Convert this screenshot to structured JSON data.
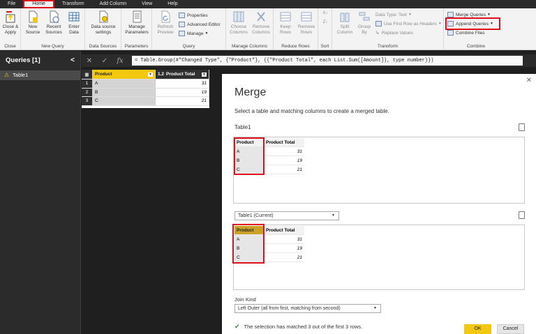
{
  "menu": [
    "File",
    "Home",
    "Transform",
    "Add Column",
    "View",
    "Help"
  ],
  "ribbon": {
    "close_group": {
      "label": "Close",
      "button": "Close &\nApply"
    },
    "new_query_group": {
      "label": "New Query",
      "new_source": "New\nSource",
      "recent_sources": "Recent\nSources",
      "enter_data": "Enter\nData"
    },
    "data_sources_group": {
      "label": "Data Sources",
      "button": "Data source\nsettings"
    },
    "parameters_group": {
      "label": "Parameters",
      "button": "Manage\nParameters"
    },
    "query_group": {
      "label": "Query",
      "refresh": "Refresh\nPreview",
      "properties": "Properties",
      "advanced_editor": "Advanced Editor",
      "manage": "Manage"
    },
    "manage_columns_group": {
      "label": "Manage Columns",
      "choose": "Choose\nColumns",
      "remove": "Remove\nColumns"
    },
    "reduce_rows_group": {
      "label": "Reduce Rows",
      "keep": "Keep\nRows",
      "remove": "Remove\nRows"
    },
    "sort_group": {
      "label": "Sort"
    },
    "transform_group": {
      "label": "Transform",
      "split": "Split\nColumn",
      "group_by": "Group\nBy",
      "data_type": "Data Type: Text",
      "first_row": "Use First Row as Headers",
      "replace": "Replace Values"
    },
    "combine_group": {
      "label": "Combine",
      "merge": "Merge Queries",
      "append": "Append Queries",
      "combine_files": "Combine Files"
    }
  },
  "queries": {
    "title": "Queries [1]",
    "items": [
      "Table1"
    ]
  },
  "formula": "= Table.Group(#\"Changed Type\", {\"Product\"}, {{\"Product Total\", each List.Sum([Amount]), type number}})",
  "grid": {
    "col1": "Product",
    "col2_type": "1.2",
    "col2": "Product Total",
    "rows": [
      {
        "n": "1",
        "p": "A",
        "v": "31"
      },
      {
        "n": "2",
        "p": "B",
        "v": "19"
      },
      {
        "n": "3",
        "p": "C",
        "v": "21"
      }
    ]
  },
  "dialog": {
    "title": "Merge",
    "description": "Select a table and matching columns to create a merged table.",
    "top_table": "Table1",
    "second_select": "Table1 (Current)",
    "col1": "Product",
    "col2": "Product Total",
    "rows": [
      {
        "p": "A",
        "v": "31"
      },
      {
        "p": "B",
        "v": "19"
      },
      {
        "p": "C",
        "v": "21"
      }
    ],
    "join_kind_label": "Join Kind",
    "join_kind": "Left Outer (all from first, matching from second)",
    "status": "The selection has matched 3 out of the first 3 rows.",
    "ok": "OK",
    "cancel": "Cancel"
  }
}
